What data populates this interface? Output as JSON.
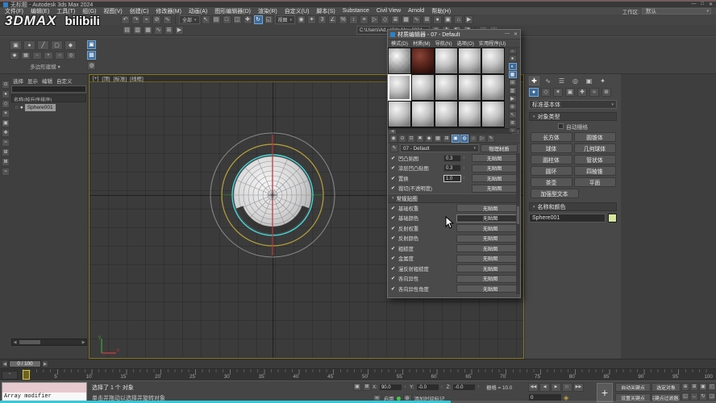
{
  "colors": {
    "accent": "#3d6a99",
    "viewportBg": "#3b3b3b",
    "gizmoYellow": "#b8a23a",
    "gizmoGray": "#9a9a9a",
    "selCyan": "#49d8d8",
    "axisRed": "#c03b3b",
    "axisGreen": "#3f8f3f",
    "swatch": "#d7e69e",
    "timelineMarker": "#d8c54a",
    "progressTeal": "#35c8d8"
  },
  "window": {
    "title": "无标题 - Autodesk 3ds Max 2024",
    "buttons": [
      {
        "name": "window-minimize-button",
        "glyph": "—"
      },
      {
        "name": "window-maximize-button",
        "glyph": "□"
      },
      {
        "name": "window-close-button",
        "glyph": "✕"
      }
    ]
  },
  "menubar": {
    "items": [
      "文件(F)",
      "编辑(E)",
      "工具(T)",
      "组(G)",
      "视图(V)",
      "创建(C)",
      "修改器(M)",
      "动画(A)",
      "图形编辑器(D)",
      "渲染(R)",
      "自定义(U)",
      "脚本(S)",
      "Substance",
      "Civil View",
      "Arnold",
      "帮助(H)"
    ],
    "workspace_label": "工作区:",
    "workspace_value": "默认"
  },
  "watermark": {
    "text1": "3DMAX",
    "text2": "bilibili"
  },
  "toolbar": {
    "icons_a": [
      {
        "name": "undo-icon",
        "glyph": "↶"
      },
      {
        "name": "redo-icon",
        "glyph": "↷"
      },
      {
        "name": "select-and-link-icon",
        "glyph": "⌁"
      },
      {
        "name": "unlink-selection-icon",
        "glyph": "⊘"
      },
      {
        "name": "bind-to-space-warp-icon",
        "glyph": "∿"
      }
    ],
    "selection_filter_value": "全部",
    "icons_b": [
      {
        "name": "select-object-icon",
        "glyph": "↖"
      },
      {
        "name": "select-by-name-icon",
        "glyph": "▤"
      },
      {
        "name": "rectangular-selection-region-icon",
        "glyph": "□"
      },
      {
        "name": "window-crossing-icon",
        "glyph": "◫"
      },
      {
        "name": "select-and-move-icon",
        "glyph": "✚"
      },
      {
        "name": "select-and-rotate-icon",
        "glyph": "↻",
        "active": true
      },
      {
        "name": "select-and-scale-icon",
        "glyph": "◱"
      }
    ],
    "refcoord_value": "视图",
    "icons_c": [
      {
        "name": "use-pivot-center-icon",
        "glyph": "◉"
      },
      {
        "name": "select-and-manipulate-icon",
        "glyph": "✦"
      },
      {
        "name": "snaps-toggle-icon",
        "glyph": "3"
      },
      {
        "name": "angle-snap-icon",
        "glyph": "∠"
      },
      {
        "name": "percent-snap-icon",
        "glyph": "%"
      },
      {
        "name": "spinner-snap-icon",
        "glyph": "↕"
      },
      {
        "name": "named-selection-sets-icon",
        "glyph": "≡"
      },
      {
        "name": "mirror-icon",
        "glyph": "▷"
      },
      {
        "name": "align-icon",
        "glyph": "◇"
      },
      {
        "name": "layer-explorer-icon",
        "glyph": "≣"
      },
      {
        "name": "ribbon-toggle-icon",
        "glyph": "▦"
      },
      {
        "name": "curve-editor-icon",
        "glyph": "∿"
      },
      {
        "name": "schematic-view-icon",
        "glyph": "⊞"
      },
      {
        "name": "material-editor-icon",
        "glyph": "●"
      },
      {
        "name": "render-setup-icon",
        "glyph": "▣"
      },
      {
        "name": "rendered-frame-icon",
        "glyph": "⌂"
      },
      {
        "name": "render-production-icon",
        "glyph": "▶"
      }
    ],
    "icons_d": [
      {
        "name": "toggle-scene-explorer-icon",
        "glyph": "▤"
      },
      {
        "name": "toggle-layer-explorer-icon",
        "glyph": "▥"
      },
      {
        "name": "toggle-ribbon-icon",
        "glyph": "▦"
      },
      {
        "name": "curve-editor-2-icon",
        "glyph": "∿"
      },
      {
        "name": "schematic-2-icon",
        "glyph": "⊞"
      },
      {
        "name": "render-shortcut-icon",
        "glyph": "▶"
      }
    ],
    "project_folder_value": "C:\\Users\\Ad…\\3ds Max 2024",
    "icons_e": [
      {
        "name": "asset-tracking-icon",
        "glyph": "◍"
      },
      {
        "name": "new-scene-explorer-icon",
        "glyph": "✚"
      },
      {
        "name": "isolate-toggle-icon",
        "glyph": "◧"
      },
      {
        "name": "display-toggle-icon",
        "glyph": "◨"
      }
    ],
    "icons_f": [
      {
        "name": "help-search-icon",
        "glyph": "◔"
      },
      {
        "name": "info-center-icon",
        "glyph": "◕"
      }
    ]
  },
  "ribbon": {
    "icons_a": [
      {
        "name": "edit-poly-mode-icon",
        "glyph": "▣"
      },
      {
        "name": "vertex-mode-icon",
        "glyph": "●"
      },
      {
        "name": "edge-mode-icon",
        "glyph": "╱"
      },
      {
        "name": "border-mode-icon",
        "glyph": "▢"
      },
      {
        "name": "polygon-mode-icon",
        "glyph": "◆"
      }
    ],
    "icons_b": [
      {
        "name": "element-mode-icon",
        "glyph": "◆"
      },
      {
        "name": "preview-selection-icon",
        "glyph": "▦"
      },
      {
        "name": "shrink-selection-icon",
        "glyph": "−"
      },
      {
        "name": "grow-selection-icon",
        "glyph": "+"
      },
      {
        "name": "loop-selection-icon",
        "glyph": "○"
      },
      {
        "name": "ring-selection-icon",
        "glyph": "◎"
      }
    ],
    "side_icons": [
      {
        "name": "isolate-selection-icon",
        "glyph": "▣",
        "active": true
      },
      {
        "name": "xview-icon",
        "glyph": "▦",
        "active": true
      },
      {
        "name": "pivot-tool-icon",
        "glyph": "◍"
      }
    ],
    "panel_label": "多边形建模 ▾"
  },
  "explorer": {
    "menu": [
      "选择",
      "显示",
      "编辑",
      "自定义"
    ],
    "header": "名称(按升序排序)",
    "item_icons": [
      "◌",
      "●"
    ],
    "item_name": "Sphere001",
    "strip_icons": [
      {
        "name": "display-all-icon",
        "glyph": "⊙"
      },
      {
        "name": "display-geometry-icon",
        "glyph": "●"
      },
      {
        "name": "display-shapes-icon",
        "glyph": "◇"
      },
      {
        "name": "display-lights-icon",
        "glyph": "✶"
      },
      {
        "name": "display-cameras-icon",
        "glyph": "▣"
      },
      {
        "name": "display-helpers-icon",
        "glyph": "✚"
      },
      {
        "name": "display-space-warps-icon",
        "glyph": "≈"
      },
      {
        "name": "display-groups-icon",
        "glyph": "⊞"
      },
      {
        "name": "display-xrefs-icon",
        "glyph": "⊠"
      },
      {
        "name": "display-bones-icon",
        "glyph": "⌁"
      }
    ],
    "scroll_left": "◀",
    "scroll_right": "▶"
  },
  "viewport": {
    "label_parts": [
      "[+]",
      "[顶]",
      "[标准]",
      "[线框]"
    ],
    "axis_x_label": "x",
    "axis_y_label": "y"
  },
  "material_editor": {
    "title": "材质编辑器 - 07 - Default",
    "minimize_glyph": "—",
    "close_glyph": "✕",
    "menu": [
      "模式(D)",
      "材质(M)",
      "导航(N)",
      "选项(O)",
      "实用程序(U)"
    ],
    "samples": [
      {
        "variant": "checker",
        "selected": false
      },
      {
        "variant": "dark",
        "selected": false
      },
      {
        "variant": "plain",
        "selected": false
      },
      {
        "variant": "plain",
        "selected": false
      },
      {
        "variant": "plain",
        "selected": false
      },
      {
        "variant": "plain",
        "selected": true
      },
      {
        "variant": "plain",
        "selected": false
      },
      {
        "variant": "plain",
        "selected": false
      },
      {
        "variant": "plain",
        "selected": false
      },
      {
        "variant": "plain",
        "selected": false
      },
      {
        "variant": "plain",
        "selected": false
      },
      {
        "variant": "plain",
        "selected": false
      },
      {
        "variant": "plain",
        "selected": false
      },
      {
        "variant": "plain",
        "selected": false
      },
      {
        "variant": "plain",
        "selected": false
      }
    ],
    "scroll_up": "∧",
    "scroll_down": "∨",
    "hscroll_left": "◀",
    "hscroll_right": "▶",
    "side_icons": [
      {
        "name": "sample-type-icon",
        "glyph": "●"
      },
      {
        "name": "backlight-icon",
        "glyph": "◐",
        "active": true
      },
      {
        "name": "background-icon",
        "glyph": "▦",
        "active": true
      },
      {
        "name": "sample-uv-tiling-icon",
        "glyph": "⊞"
      },
      {
        "name": "video-color-check-icon",
        "glyph": "▥"
      },
      {
        "name": "make-preview-icon",
        "glyph": "▶"
      },
      {
        "name": "options-icon",
        "glyph": "⊛"
      },
      {
        "name": "select-by-material-icon",
        "glyph": "↖"
      },
      {
        "name": "material-map-navigator-icon",
        "glyph": "≣"
      }
    ],
    "toolbar_icons": [
      {
        "name": "get-material-icon",
        "glyph": "◉"
      },
      {
        "name": "put-material-to-scene-icon",
        "glyph": "⊙"
      },
      {
        "name": "assign-material-to-selection-icon",
        "glyph": "⊡"
      },
      {
        "name": "reset-map-icon",
        "glyph": "✖"
      },
      {
        "name": "make-unique-icon",
        "glyph": "◆"
      },
      {
        "name": "put-to-library-icon",
        "glyph": "▦"
      },
      {
        "name": "material-id-channel-icon",
        "glyph": "⊞"
      },
      {
        "name": "show-shaded-material-in-viewport-icon",
        "glyph": "▣",
        "active": true
      },
      {
        "name": "show-end-result-icon",
        "glyph": "◍",
        "active": true
      },
      {
        "name": "go-to-parent-icon",
        "glyph": "⌂"
      },
      {
        "name": "go-forward-to-sibling-icon",
        "glyph": "▷"
      },
      {
        "name": "pick-material-from-object-icon",
        "glyph": "✎"
      }
    ],
    "eyedropper_glyph": "✎",
    "material_name": "07 - Default",
    "dd_arrow": "▾",
    "type_button": "物理材质",
    "special_maps": [
      {
        "label": "凹凸贴图",
        "amount": "0.3",
        "button": "无贴图",
        "focused": false
      },
      {
        "label": "涂层凹凸贴图",
        "amount": "0.3",
        "button": "无贴图",
        "focused": false
      },
      {
        "label": "置换",
        "amount": "1.0",
        "button": "无贴图",
        "focused": true
      },
      {
        "label": "裁切(不透明度)",
        "amount": "",
        "button": "无贴图",
        "focused": false
      }
    ],
    "generic_header": "常规贴图",
    "generic_maps": [
      {
        "label": "基础权重",
        "button": "无贴图",
        "hl": false
      },
      {
        "label": "基础颜色",
        "button": "无贴图",
        "hl": true
      },
      {
        "label": "反射权重",
        "button": "无贴图",
        "hl": false
      },
      {
        "label": "反射颜色",
        "button": "无贴图",
        "hl": false
      },
      {
        "label": "粗糙度",
        "button": "无贴图",
        "hl": false
      },
      {
        "label": "金属度",
        "button": "无贴图",
        "hl": false
      },
      {
        "label": "漫反射粗糙度",
        "button": "无贴图",
        "hl": false
      },
      {
        "label": "各向异性",
        "button": "无贴图",
        "hl": false
      },
      {
        "label": "各向异性角度",
        "button": "无贴图",
        "hl": false
      }
    ]
  },
  "command_panel": {
    "tabs": [
      {
        "name": "tab-create",
        "glyph": "✚",
        "active": true
      },
      {
        "name": "tab-modify",
        "glyph": "∿"
      },
      {
        "name": "tab-hierarchy",
        "glyph": "☰"
      },
      {
        "name": "tab-motion",
        "glyph": "◎"
      },
      {
        "name": "tab-display",
        "glyph": "▣"
      },
      {
        "name": "tab-utilities",
        "glyph": "✦"
      }
    ],
    "subtabs": [
      {
        "name": "subtab-geometry",
        "glyph": "●",
        "active": true
      },
      {
        "name": "subtab-shapes",
        "glyph": "◇"
      },
      {
        "name": "subtab-lights",
        "glyph": "✶"
      },
      {
        "name": "subtab-cameras",
        "glyph": "▣"
      },
      {
        "name": "subtab-helpers",
        "glyph": "✚"
      },
      {
        "name": "subtab-space-warps",
        "glyph": "≈"
      },
      {
        "name": "subtab-systems",
        "glyph": "⊛"
      }
    ],
    "category_value": "标准基本体",
    "dd_arrow": "▾",
    "object_type_header": "对象类型",
    "autogrid_label": "自动栅格",
    "object_buttons": [
      {
        "label": "长方体",
        "wide": false
      },
      {
        "label": "圆锥体",
        "wide": false
      },
      {
        "label": "球体",
        "wide": false
      },
      {
        "label": "几何球体",
        "wide": false
      },
      {
        "label": "圆柱体",
        "wide": false
      },
      {
        "label": "管状体",
        "wide": false
      },
      {
        "label": "圆环",
        "wide": false
      },
      {
        "label": "四棱锥",
        "wide": false
      },
      {
        "label": "茶壶",
        "wide": false
      },
      {
        "label": "平面",
        "wide": false
      },
      {
        "label": "加强型文本",
        "wide": true
      }
    ],
    "name_color_header": "名称和颜色",
    "object_name": "Sphere001"
  },
  "timeline": {
    "slider_label": "0 / 100",
    "arrow_left": "◀",
    "arrow_right": "▶",
    "tick_labels": [
      "5",
      "10",
      "15",
      "20",
      "25",
      "30",
      "35",
      "40",
      "45",
      "50",
      "55",
      "60",
      "65",
      "70",
      "75",
      "80",
      "85",
      "90",
      "95",
      "100"
    ]
  },
  "statusbar": {
    "listener_text": "Array modifier",
    "status_line": "选择了 1 个 对象",
    "prompt_line": "单击并拖动以选择并旋转对象",
    "isolate_glyph": "▣",
    "lock_glyph": "⊠",
    "coords": {
      "x_label": "X:",
      "x": "90.0",
      "y_label": "Y:",
      "y": "-0.0",
      "z_label": "Z:",
      "z": "-0.0",
      "spinner": "↕"
    },
    "grid_label": "栅格 = 10.0",
    "maxscript_glyph": "≋",
    "enable_label": "启用",
    "abs_transform_glyph": "⊕",
    "time_tag_label": "添加时间标记",
    "playback": [
      {
        "name": "go-to-start-button",
        "glyph": "◀◀"
      },
      {
        "name": "previous-frame-button",
        "glyph": "◀"
      },
      {
        "name": "play-button",
        "glyph": "▶"
      },
      {
        "name": "next-frame-button",
        "glyph": "▷"
      },
      {
        "name": "go-to-end-button",
        "glyph": "▶▶"
      }
    ],
    "frame_value": "0",
    "key_mode_glyph": "◈",
    "big_plus_glyph": "+",
    "autokey_label": "自动关键点",
    "selected_dd_label": "选定对象",
    "setkey_label": "设置关键点",
    "keyfilters_label": "关键点过滤器...",
    "nav_icons": [
      {
        "name": "zoom-icon",
        "glyph": "⊕"
      },
      {
        "name": "zoom-all-icon",
        "glyph": "⊞"
      },
      {
        "name": "zoom-extents-icon",
        "glyph": "▣"
      },
      {
        "name": "zoom-extents-all-icon",
        "glyph": "◰"
      },
      {
        "name": "field-of-view-icon",
        "glyph": "◱"
      },
      {
        "name": "pan-icon",
        "glyph": "↔"
      },
      {
        "name": "orbit-icon",
        "glyph": "↻"
      },
      {
        "name": "maximize-viewport-icon",
        "glyph": "◲"
      }
    ]
  }
}
